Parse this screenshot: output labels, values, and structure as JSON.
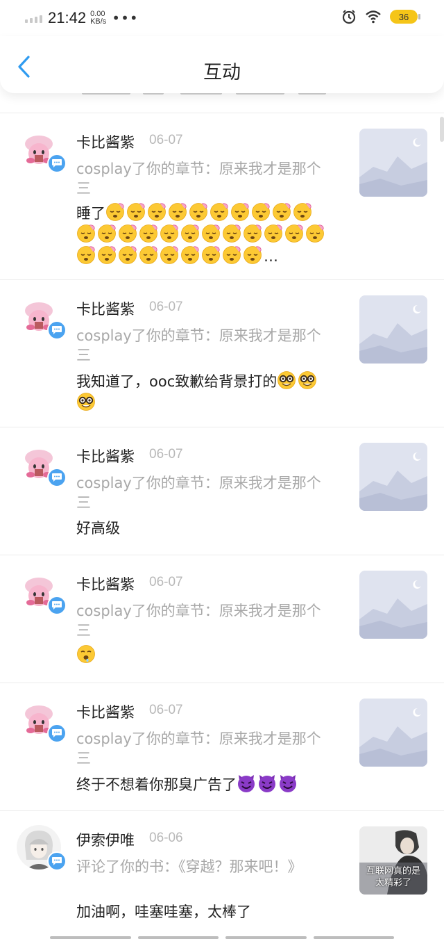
{
  "status_bar": {
    "time": "21:42",
    "net_speed": "0.00",
    "net_unit": "KB/s",
    "battery": "36",
    "icons": [
      "signal-icon",
      "more-dots-icon",
      "alarm-icon",
      "wifi-icon",
      "battery-icon"
    ]
  },
  "nav": {
    "title": "互动",
    "back_icon": "chevron-left-icon",
    "accent_color": "#2f9bf0"
  },
  "items": [
    {
      "user": "卡比酱紫",
      "date": "06-07",
      "action": "cosplay了你的章节：原来我才是那个三",
      "comment_text": "睡了",
      "emoji": "sleeping-face",
      "emoji_count": 31,
      "truncated": "…"
    },
    {
      "user": "卡比酱紫",
      "date": "06-07",
      "action": "cosplay了你的章节：原来我才是那个三",
      "comment_text": "我知道了，ooc致歉给背景打的",
      "emoji": "nerd-face",
      "emoji_count": 3
    },
    {
      "user": "卡比酱紫",
      "date": "06-07",
      "action": "cosplay了你的章节：原来我才是那个三",
      "comment_text": "好高级"
    },
    {
      "user": "卡比酱紫",
      "date": "06-07",
      "action": "cosplay了你的章节：原来我才是那个三",
      "comment_text": "",
      "emoji": "drooling-face",
      "emoji_count": 1
    },
    {
      "user": "卡比酱紫",
      "date": "06-07",
      "action": "cosplay了你的章节：原来我才是那个三",
      "comment_text": "终于不想着你那臭广告了",
      "emoji": "smiling-imp",
      "emoji_count": 3
    },
    {
      "user": "伊索伊唯",
      "date": "06-06",
      "action": "评论了你的书：《穿越？那来吧！》",
      "comment_text": "加油啊，哇塞哇塞，太棒了",
      "thumb_caption": "互联网真的是太精彩了"
    }
  ]
}
